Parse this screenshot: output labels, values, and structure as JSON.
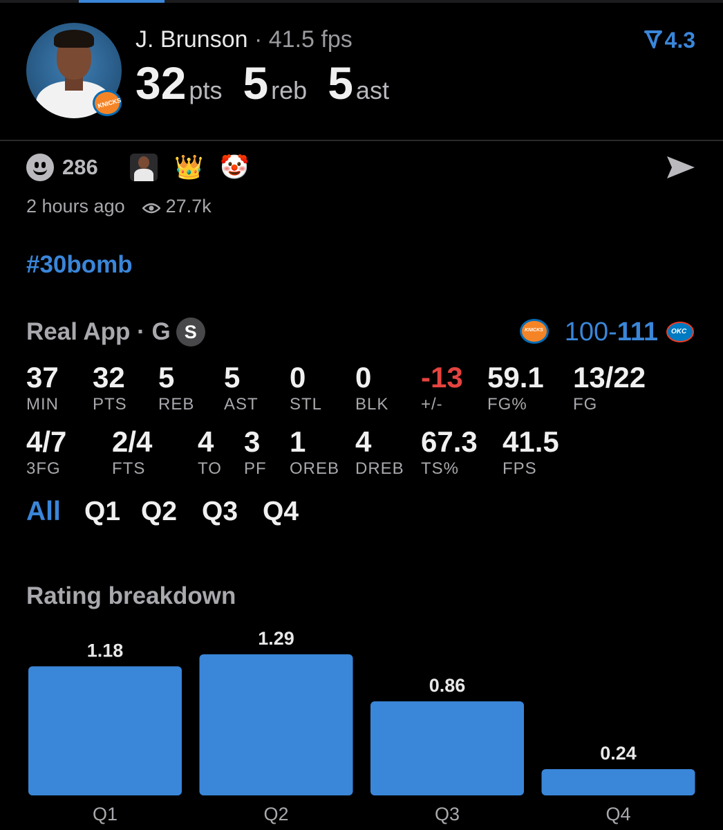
{
  "player": {
    "name": "J. Brunson",
    "separator": "·",
    "fps_text": "41.5 fps",
    "pts": "32",
    "pts_label": "pts",
    "reb": "5",
    "reb_label": "reb",
    "ast": "5",
    "ast_label": "ast",
    "team_badge": "KNICKS"
  },
  "rating_value": "4.3",
  "reactions": {
    "count": "286",
    "crown": "👑",
    "clown": "🤡"
  },
  "meta": {
    "time_ago": "2 hours ago",
    "views": "27.7k"
  },
  "hashtag": "#30bomb",
  "game": {
    "source": "Real App · G",
    "badge": "S",
    "home_score": "100",
    "dash": "-",
    "away_score": "111",
    "home_logo_text": "KNICKS",
    "away_logo_text": "OKC"
  },
  "stats_row1": [
    {
      "value": "37",
      "label": "MIN"
    },
    {
      "value": "32",
      "label": "PTS"
    },
    {
      "value": "5",
      "label": "REB"
    },
    {
      "value": "5",
      "label": "AST"
    },
    {
      "value": "0",
      "label": "STL"
    },
    {
      "value": "0",
      "label": "BLK"
    },
    {
      "value": "-13",
      "label": "+/-"
    },
    {
      "value": "59.1",
      "label": "FG%"
    },
    {
      "value": "13/22",
      "label": "FG"
    }
  ],
  "stats_row2": [
    {
      "value": "4/7",
      "label": "3FG"
    },
    {
      "value": "2/4",
      "label": "FTS"
    },
    {
      "value": "4",
      "label": "TO"
    },
    {
      "value": "3",
      "label": "PF"
    },
    {
      "value": "1",
      "label": "OREB"
    },
    {
      "value": "4",
      "label": "DREB"
    },
    {
      "value": "67.3",
      "label": "TS%"
    },
    {
      "value": "41.5",
      "label": "FPS"
    }
  ],
  "quarter_tabs": [
    "All",
    "Q1",
    "Q2",
    "Q3",
    "Q4"
  ],
  "rating_breakdown_title": "Rating breakdown",
  "colors": {
    "accent": "#3a86d9",
    "negative": "#e5433f",
    "bar": "#3a86d9"
  },
  "chart_data": {
    "type": "bar",
    "title": "Rating breakdown",
    "categories": [
      "Q1",
      "Q2",
      "Q3",
      "Q4"
    ],
    "values": [
      1.18,
      1.29,
      0.86,
      0.24
    ],
    "data_labels": [
      "1.18",
      "1.29",
      "0.86",
      "0.24"
    ],
    "ylim": [
      0,
      1.29
    ],
    "grid": false
  }
}
